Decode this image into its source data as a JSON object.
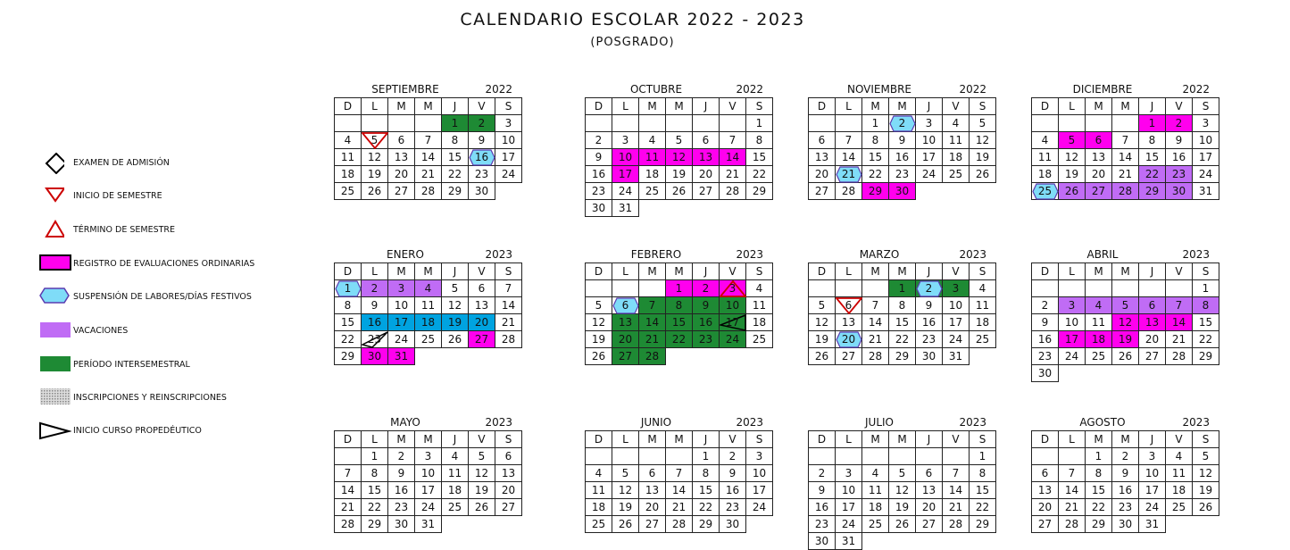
{
  "title": "CALENDARIO ESCOLAR 2022 - 2023",
  "subtitle": "(POSGRADO)",
  "day_headers": [
    "D",
    "L",
    "M",
    "M",
    "J",
    "V",
    "S"
  ],
  "colors": {
    "intersemestral": "#1e8a34",
    "registro": "#ff00ee",
    "vacaciones": "#c06cf5",
    "semana_azul": "#00a3e0",
    "suspension": "#7fdcf8",
    "semestre": "#cc0000"
  },
  "legend": [
    {
      "icon": "diamond-icon",
      "label": "EXAMEN DE ADMISIÓN"
    },
    {
      "icon": "triangle-down-icon",
      "label": "INICIO DE SEMESTRE"
    },
    {
      "icon": "triangle-up-icon",
      "label": "TÉRMINO DE SEMESTRE"
    },
    {
      "icon": "magenta-box-icon",
      "label": "REGISTRO DE EVALUACIONES ORDINARIAS"
    },
    {
      "icon": "hexagon-icon",
      "label": "SUSPENSIÓN DE LABORES/DÍAS FESTIVOS"
    },
    {
      "icon": "purple-box-icon",
      "label": "VACACIONES"
    },
    {
      "icon": "green-box-icon",
      "label": "PERÍODO INTERSEMESTRAL"
    },
    {
      "icon": "hatched-box-icon",
      "label": "INSCRIPCIONES Y REINSCRIPCIONES"
    },
    {
      "icon": "arrow-triangle-icon",
      "label": "INICIO CURSO PROPEDÉUTICO"
    }
  ],
  "months": [
    {
      "name": "SEPTIEMBRE",
      "year": "2022",
      "start": 4,
      "days": 30,
      "styles": {
        "1": "g",
        "2": "g"
      },
      "marks": {
        "5": "tri-down",
        "16": "hex"
      }
    },
    {
      "name": "OCTUBRE",
      "year": "2022",
      "start": 6,
      "days": 31,
      "styles": {
        "10": "m",
        "11": "m",
        "12": "m",
        "13": "m",
        "14": "m",
        "17": "m"
      },
      "marks": {}
    },
    {
      "name": "NOVIEMBRE",
      "year": "2022",
      "start": 2,
      "days": 30,
      "styles": {
        "29": "m",
        "30": "m"
      },
      "marks": {
        "2": "hex",
        "21": "hex"
      }
    },
    {
      "name": "DICIEMBRE",
      "year": "2022",
      "start": 4,
      "days": 31,
      "styles": {
        "1": "m",
        "2": "m",
        "5": "m",
        "6": "m",
        "22": "v",
        "23": "v",
        "26": "v",
        "27": "v",
        "28": "v",
        "29": "v",
        "30": "v"
      },
      "marks": {
        "25": "hex"
      }
    },
    {
      "name": "ENERO",
      "year": "2023",
      "start": 0,
      "days": 31,
      "styles": {
        "2": "v",
        "3": "v",
        "4": "v",
        "16": "b",
        "17": "b",
        "18": "b",
        "19": "b",
        "20": "b",
        "27": "m",
        "30": "m",
        "31": "m"
      },
      "marks": {
        "1": "hex",
        "23": "arrow"
      }
    },
    {
      "name": "FEBRERO",
      "year": "2023",
      "start": 3,
      "days": 28,
      "styles": {
        "1": "m",
        "2": "m",
        "3": "m",
        "7": "g",
        "8": "g",
        "9": "g",
        "10": "g",
        "13": "g",
        "14": "g",
        "15": "g",
        "16": "g",
        "17": "g",
        "20": "g",
        "21": "g",
        "22": "g",
        "23": "g",
        "24": "g",
        "27": "g",
        "28": "g"
      },
      "marks": {
        "3": "tri-up",
        "6": "hex",
        "17": "arrow-left"
      }
    },
    {
      "name": "MARZO",
      "year": "2023",
      "start": 3,
      "days": 31,
      "styles": {
        "1": "g",
        "2": "g",
        "3": "g"
      },
      "marks": {
        "2": "hex",
        "6": "tri-down",
        "20": "hex"
      }
    },
    {
      "name": "ABRIL",
      "year": "2023",
      "start": 6,
      "days": 30,
      "styles": {
        "3": "v",
        "4": "v",
        "5": "v",
        "6": "v",
        "7": "v",
        "8": "v",
        "12": "m",
        "13": "m",
        "14": "m",
        "17": "m",
        "18": "m",
        "19": "m"
      },
      "marks": {}
    },
    {
      "name": "MAYO",
      "year": "2023",
      "start": 1,
      "days": 31,
      "styles": {},
      "marks": {}
    },
    {
      "name": "JUNIO",
      "year": "2023",
      "start": 4,
      "days": 30,
      "styles": {},
      "marks": {}
    },
    {
      "name": "JULIO",
      "year": "2023",
      "start": 6,
      "days": 31,
      "styles": {},
      "marks": {}
    },
    {
      "name": "AGOSTO",
      "year": "2023",
      "start": 2,
      "days": 31,
      "styles": {},
      "marks": {}
    }
  ]
}
